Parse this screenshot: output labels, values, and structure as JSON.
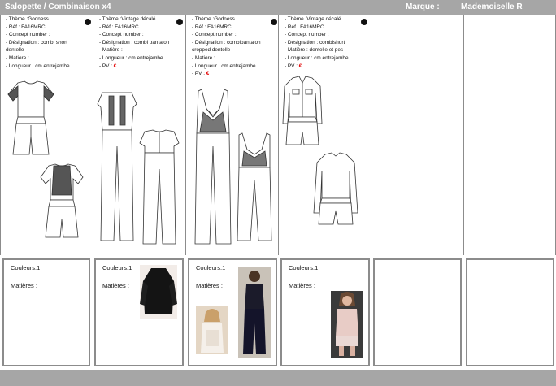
{
  "header": {
    "title": "Salopette / Combinaison x4",
    "brand_label": "Marque :",
    "brand_value": "Mademoiselle R"
  },
  "products": [
    {
      "lines": [
        "- Thème :Godness",
        "- Réf : FA16MRC",
        "-  Concept number :",
        "- Désignation : combi short",
        "dentelle",
        "-     Matière :",
        "- Longueur :  cm entrejambe"
      ],
      "colors_label": "Couleurs:1",
      "materials_label": "Matières :"
    },
    {
      "lines": [
        "- Thème :Vintage décalé",
        "- Réf : FA16MRC",
        "-  Concept number :",
        "- Désignation : combi pantalon",
        "- Matière :",
        "- Longueur :  cm entrejambe",
        "- PV : "
      ],
      "pv_symbol": "€",
      "colors_label": "Couleurs:1",
      "materials_label": "Matières :"
    },
    {
      "lines": [
        "- Thème :Godness",
        "- Réf : FA16MRC",
        "-  Concept number :",
        "- Désignation : combipantalon",
        "cropped dentelle",
        "- Matière :",
        "- Longueur :  cm entrejambe",
        "- PV : "
      ],
      "pv_symbol": "€",
      "colors_label": "Couleurs:1",
      "materials_label": "Matières :"
    },
    {
      "lines": [
        "- Thème :Vintage décalé",
        "- Réf : FA16MRC",
        "-  Concept number :",
        "- Désignation : combishort",
        "- Matière : dentelle et pes",
        "- Longueur :  cm entrejambe",
        "- PV : "
      ],
      "pv_symbol": "€",
      "colors_label": "Couleurs:1",
      "materials_label": "Matières :"
    }
  ],
  "icons": {
    "status_dot": "black-dot-icon"
  },
  "colors": {
    "header_bar": "#a6a6a6",
    "border": "#8c8c8c",
    "price_accent": "#e30000"
  }
}
